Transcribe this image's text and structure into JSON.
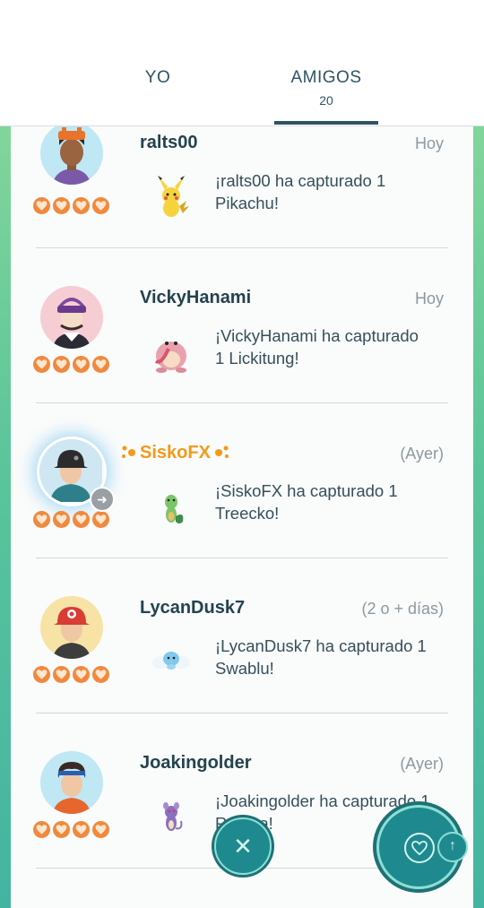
{
  "tabs": {
    "yo": {
      "label": "YO"
    },
    "amigos": {
      "label": "AMIGOS",
      "count": "20"
    }
  },
  "feed": [
    {
      "name": "ralts00",
      "time": "Hoy",
      "message": "¡ralts00 ha capturado 1 Pikachu!",
      "pokemon": "pikachu",
      "hearts": 4,
      "special": false
    },
    {
      "name": "VickyHanami",
      "time": "Hoy",
      "message": "¡VickyHanami ha capturado 1 Lickitung!",
      "pokemon": "lickitung",
      "hearts": 4,
      "special": false
    },
    {
      "name": "SiskoFX",
      "time": "(Ayer)",
      "message": "¡SiskoFX ha capturado 1 Treecko!",
      "pokemon": "treecko",
      "hearts": 4,
      "special": true
    },
    {
      "name": "LycanDusk7",
      "time": "(2 o + días)",
      "message": "¡LycanDusk7 ha capturado 1 Swablu!",
      "pokemon": "swablu",
      "hearts": 4,
      "special": false
    },
    {
      "name": "Joakingolder",
      "time": "(Ayer)",
      "message": "¡Joakingolder ha capturado 1 Rattata!",
      "pokemon": "rattata",
      "hearts": 4,
      "special": false
    }
  ],
  "icons": {
    "close": "close-icon",
    "heart": "heart-icon",
    "arrow_up": "arrow-up-icon",
    "arrow_right": "arrow-right-icon"
  },
  "colors": {
    "accent": "#1e8a8f",
    "heart": "#f0893e",
    "special_name": "#f29a18"
  }
}
